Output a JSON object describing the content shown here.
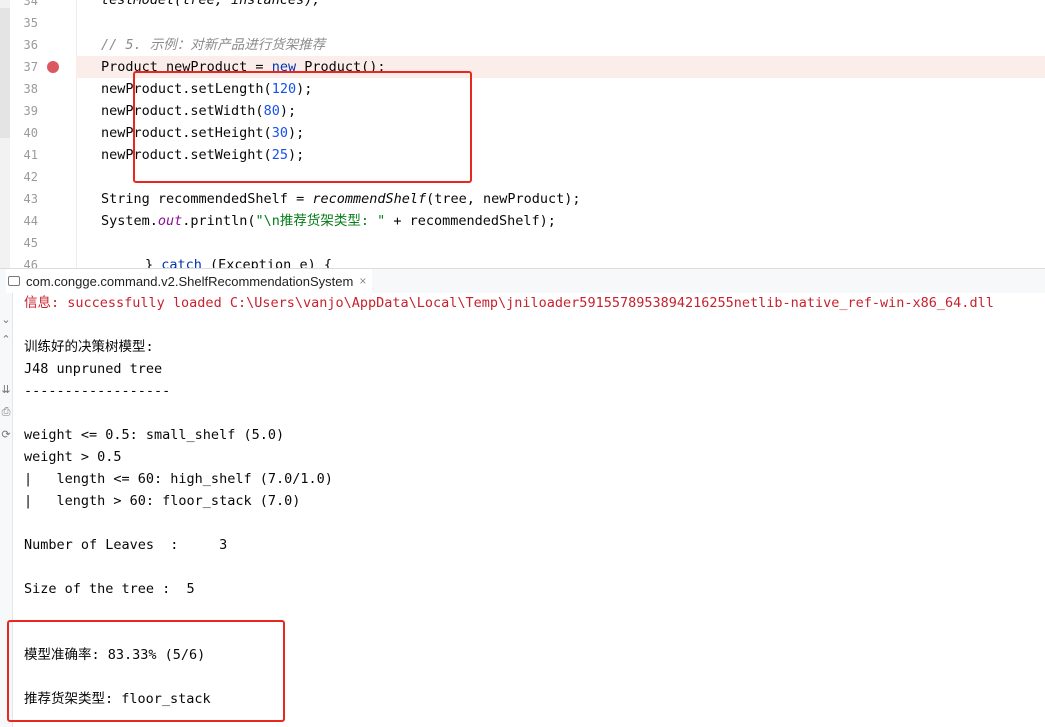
{
  "editor": {
    "line_numbers": [
      "34",
      "35",
      "36",
      "37",
      "38",
      "39",
      "40",
      "41",
      "42",
      "43",
      "44",
      "45",
      "46"
    ],
    "code": {
      "l34": "testModel(tree, instances);",
      "l36_comment": "// 5. 示例：对新产品进行货架推荐",
      "l37_type": "Product newProduct = ",
      "l37_kw": "new",
      "l37_rest": " Product();",
      "l38_call": "newProduct.setLength(",
      "l38_num": "120",
      "l38_end": ");",
      "l39_call": "newProduct.setWidth(",
      "l39_num": "80",
      "l39_end": ");",
      "l40_call": "newProduct.setHeight(",
      "l40_num": "30",
      "l40_end": ");",
      "l41_call": "newProduct.setWeight(",
      "l41_num": "25",
      "l41_end": ");",
      "l43_a": "String recommendedShelf = ",
      "l43_method": "recommendShelf",
      "l43_b": "(tree, newProduct);",
      "l44_a": "System.",
      "l44_field": "out",
      "l44_b": ".println(",
      "l44_str": "\"\\n推荐货架类型: \"",
      "l44_c": " + recommendedShelf);",
      "l46_a": "} ",
      "l46_kw": "catch",
      "l46_b": " (Exception e) {"
    }
  },
  "run_tab": {
    "label": "com.congge.command.v2.ShelfRecommendationSystem",
    "close": "×",
    "side_icons": [
      "⌄",
      "⌃",
      "⇊",
      "⎙",
      "⟳"
    ]
  },
  "console": {
    "info_prefix": "信息: ",
    "info_message": "successfully loaded C:\\Users\\vanjo\\AppData\\Local\\Temp\\jniloader5915578953894216255netlib-native_ref-win-x86_64.dll",
    "tree_title": "训练好的决策树模型:",
    "tree_name": "J48 unpruned tree",
    "separator": "------------------",
    "tree_lines": [
      "weight <= 0.5: small_shelf (5.0)",
      "weight > 0.5",
      "|   length <= 60: high_shelf (7.0/1.0)",
      "|   length > 60: floor_stack (7.0)"
    ],
    "leaves": "Number of Leaves  :     3",
    "size": "Size of the tree :  5",
    "accuracy": "模型准确率: 83.33% (5/6)",
    "recommendation": "推荐货架类型: floor_stack"
  },
  "colors": {
    "annotation_box": "#e8271f",
    "breakpoint": "#db5860",
    "keyword": "#0033b3",
    "number": "#1750eb",
    "error_text": "#c7222d"
  }
}
